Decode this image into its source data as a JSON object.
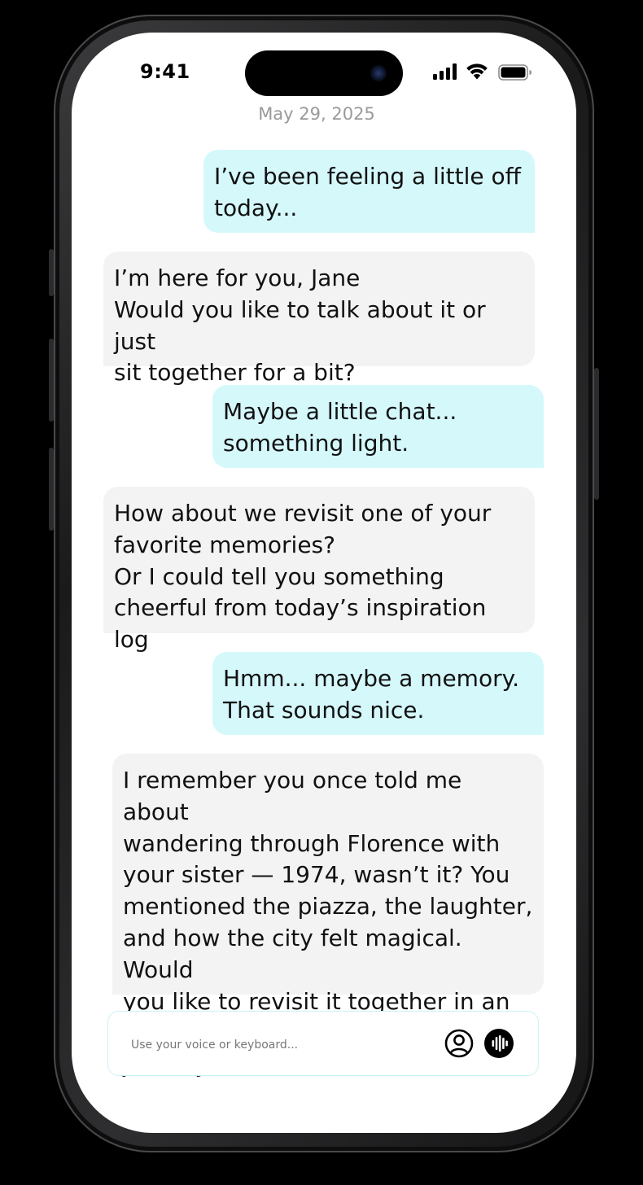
{
  "status_bar": {
    "time": "9:41",
    "icons": [
      "cellular-signal-icon",
      "wifi-icon",
      "battery-icon"
    ]
  },
  "chat": {
    "date": "May 29, 2025",
    "messages": [
      {
        "sender": "user",
        "text": "I’ve been feeling a little off\ntoday..."
      },
      {
        "sender": "ai",
        "text": "I’m here for you, Jane\nWould you like to talk about it or just\nsit together for a bit?"
      },
      {
        "sender": "user",
        "text": "Maybe a little chat...\nsomething light."
      },
      {
        "sender": "ai",
        "text": "How about we revisit one of your\nfavorite memories?\nOr I could tell you something\ncheerful from today’s inspiration log"
      },
      {
        "sender": "user",
        "text": "Hmm... maybe a memory.\nThat sounds nice."
      },
      {
        "sender": "ai",
        "text": "I remember you once told me about\nwandering through Florence with\nyour sister — 1974, wasn’t it? You\nmentioned the piazza, the laughter,\nand how the city felt magical. Would\nyou like to revisit it together in an XR\njourney?"
      }
    ]
  },
  "composer": {
    "placeholder": "Use your voice or keyboard...",
    "value": "",
    "icons": [
      "user-profile-icon",
      "voice-waveform-icon"
    ]
  },
  "colors": {
    "user_bubble": "#d5f8fb",
    "ai_bubble": "#f3f3f4",
    "input_border": "#c9f3f5",
    "date_text": "#9a9a9a"
  }
}
